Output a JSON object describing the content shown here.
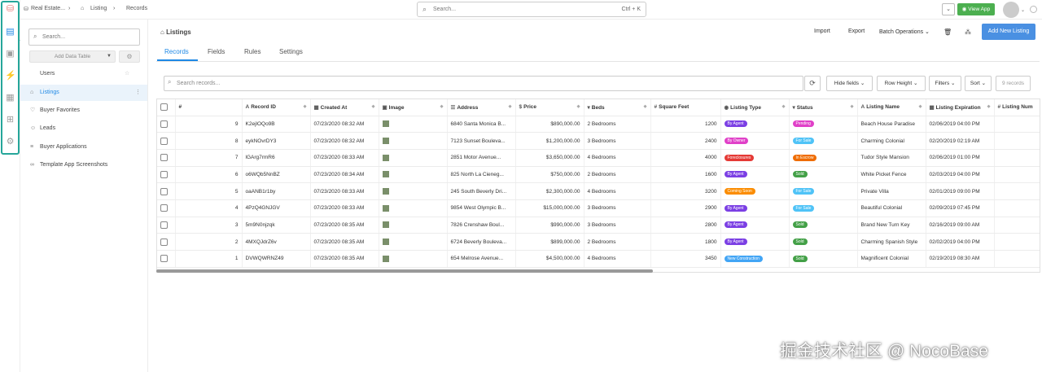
{
  "breadcrumbs": [
    "Real Estate...",
    "Listing",
    "Records"
  ],
  "search": {
    "placeholder": "Search...",
    "shortcut": "Ctrl + K"
  },
  "header": {
    "view_app": "View App"
  },
  "sidebar": {
    "search_placeholder": "Search...",
    "add_table": "Add Data Table",
    "items": [
      {
        "label": "Users",
        "icon": "user-icon"
      },
      {
        "label": "Listings",
        "icon": "home-icon"
      },
      {
        "label": "Buyer Favorites",
        "icon": "heart-icon"
      },
      {
        "label": "Leads",
        "icon": "people-icon"
      },
      {
        "label": "Buyer Applications",
        "icon": "list-icon"
      },
      {
        "label": "Template App Screenshots",
        "icon": "link-icon"
      }
    ]
  },
  "main": {
    "title": "Listings",
    "actions": {
      "import": "Import",
      "export": "Export",
      "batch": "Batch Operations"
    },
    "add_button": "Add New Listing",
    "tabs": [
      "Records",
      "Fields",
      "Rules",
      "Settings"
    ],
    "records_search_placeholder": "Search records...",
    "toolbar": {
      "hide_fields": "Hide fields",
      "row_height": "Row Height",
      "filters": "Filters",
      "sort": "Sort",
      "count": "9 records"
    }
  },
  "table": {
    "columns": [
      "#",
      "Record ID",
      "Created At",
      "Image",
      "Address",
      "Price",
      "Beds",
      "Square Feet",
      "Listing Type",
      "Status",
      "Listing Name",
      "Listing Expiration",
      "Listing Num"
    ],
    "rows": [
      {
        "n": "9",
        "id": "K2ejlOQo9B",
        "created": "07/23/2020 08:32 AM",
        "address": "6840 Santa Monica B...",
        "price": "$890,000.00",
        "beds": "2 Bedrooms",
        "sqft": "1200",
        "type": "By Agent",
        "status": "Pending",
        "name": "Beach House Paradise",
        "exp": "02/06/2019 04:00 PM"
      },
      {
        "n": "8",
        "id": "eykNOvrDY3",
        "created": "07/23/2020 08:32 AM",
        "address": "7123 Sunset Bouleva...",
        "price": "$1,200,000.00",
        "beds": "3 Bedrooms",
        "sqft": "2400",
        "type": "By Owner",
        "status": "For Sale",
        "name": "Charming Colonial",
        "exp": "02/20/2019 02:19 AM"
      },
      {
        "n": "7",
        "id": "lGArg7rmR6",
        "created": "07/23/2020 08:33 AM",
        "address": "2851 Motor Avenue...",
        "price": "$3,650,000.00",
        "beds": "4 Bedrooms",
        "sqft": "4000",
        "type": "Foreclosures",
        "status": "In Escrow",
        "name": "Tudor Style Mansion",
        "exp": "02/06/2019 01:00 PM"
      },
      {
        "n": "6",
        "id": "o6WQb5NnBZ",
        "created": "07/23/2020 08:34 AM",
        "address": "825 North La Cieneg...",
        "price": "$750,000.00",
        "beds": "2 Bedrooms",
        "sqft": "1600",
        "type": "By Agent",
        "status": "Sold",
        "name": "White Picket Fence",
        "exp": "02/03/2019 04:00 PM"
      },
      {
        "n": "5",
        "id": "oaANB1r1by",
        "created": "07/23/2020 08:33 AM",
        "address": "245 South Beverly Dri...",
        "price": "$2,300,000.00",
        "beds": "4 Bedrooms",
        "sqft": "3200",
        "type": "Coming Soon",
        "status": "For Sale",
        "name": "Private Villa",
        "exp": "02/01/2019 09:00 PM"
      },
      {
        "n": "4",
        "id": "4PzQ4GNJGV",
        "created": "07/23/2020 08:33 AM",
        "address": "9854 West Olympic B...",
        "price": "$15,000,000.00",
        "beds": "3 Bedrooms",
        "sqft": "2900",
        "type": "By Agent",
        "status": "For Sale",
        "name": "Beautiful Colonial",
        "exp": "02/09/2019 07:45 PM"
      },
      {
        "n": "3",
        "id": "5m9N0njzqk",
        "created": "07/23/2020 08:35 AM",
        "address": "7826 Crenshaw Boul...",
        "price": "$990,000.00",
        "beds": "3 Bedrooms",
        "sqft": "2800",
        "type": "By Agent",
        "status": "Sold",
        "name": "Brand New Turn Key",
        "exp": "02/16/2019 09:00 AM"
      },
      {
        "n": "2",
        "id": "4MXQJdrZ6v",
        "created": "07/23/2020 08:35 AM",
        "address": "6724 Beverly Bouleva...",
        "price": "$899,000.00",
        "beds": "2 Bedrooms",
        "sqft": "1800",
        "type": "By Agent",
        "status": "Sold",
        "name": "Charming Spanish Style",
        "exp": "02/02/2019 04:00 PM"
      },
      {
        "n": "1",
        "id": "DVWQWRNZ49",
        "created": "07/23/2020 08:35 AM",
        "address": "654 Melrose Avenue...",
        "price": "$4,500,000.00",
        "beds": "4 Bedrooms",
        "sqft": "3450",
        "type": "New Construction",
        "status": "Sold",
        "name": "Magnificent Colonial",
        "exp": "02/19/2019 08:30 AM"
      }
    ]
  },
  "pill_colors": {
    "By Agent": "#7b3fe4",
    "By Owner": "#e040c8",
    "Foreclosures": "#e53935",
    "Coming Soon": "#fb8c00",
    "New Construction": "#42a5f5",
    "Pending": "#e040c8",
    "For Sale": "#4fc3f7",
    "In Escrow": "#ef6c00",
    "Sold": "#43a047"
  },
  "watermark": "掘金技术社区 @ NocoBase"
}
